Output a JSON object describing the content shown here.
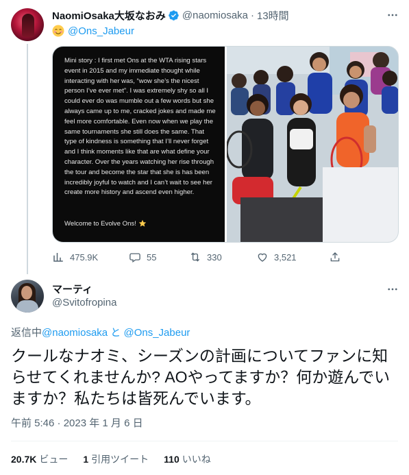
{
  "tweet": {
    "author_name": "NaomiOsaka大坂なおみ",
    "author_handle": "@naomiosaka",
    "separator": "·",
    "time": "13時間",
    "mention": "@Ons_Jabeur",
    "story_text": "Mini story : I first met Ons at the WTA rising stars event in 2015 and my immediate thought while interacting with her was, “wow she’s the nicest person I’ve ever met”. I was extremely shy so all I could ever do was mumble out a few words but she always came up to me, cracked jokes and made me feel more comfortable. Even now when we play the same tournaments she still does the same. That type of kindness is something that I’ll never forget and I think moments like that are what define your character. Over the years watching her rise through the tour and become the star that she is has been incredibly joyful to watch and I can’t wait to see her create more history and ascend even higher.",
    "story_welcome": "Welcome to Evolve Ons!",
    "actions": {
      "views": "475.9K",
      "replies": "55",
      "retweets": "330",
      "likes": "3,521"
    }
  },
  "reply": {
    "author_name": "マーティ",
    "author_handle": "@Svitofropina",
    "replying_prefix": "返信中",
    "replying_user1": "@naomiosaka",
    "replying_and": " と ",
    "replying_user2": "@Ons_Jabeur",
    "text": "クールなナオミ、シーズンの計画についてファンに知らせてくれませんか? AOやってますか？何か遊んでいますか？私たちは皆死んでいます。",
    "timestamp": "午前 5:46 · 2023 年 1 月 6 日",
    "stats": {
      "views_count": "20.7K",
      "views_label": "ビュー",
      "quotes_count": "1",
      "quotes_label": "引用ツイート",
      "likes_count": "110",
      "likes_label": "いいね"
    }
  },
  "colors": {
    "accent": "#1d9bf0",
    "text": "#0f1419",
    "secondary": "#536471",
    "border": "#eff3f4"
  }
}
